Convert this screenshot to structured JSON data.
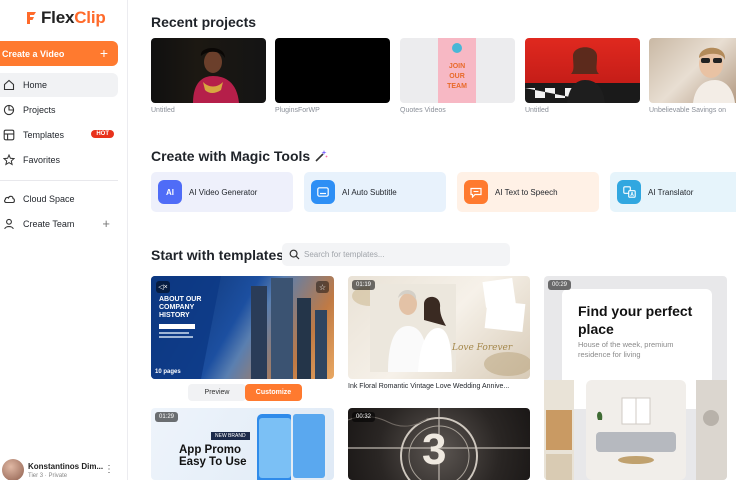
{
  "brand": {
    "logo_prefix": "Flex",
    "logo_suffix": "Clip",
    "accent": "#ff7a2f"
  },
  "sidebar": {
    "create_label": "Create a Video",
    "items": [
      {
        "label": "Home"
      },
      {
        "label": "Projects"
      },
      {
        "label": "Templates",
        "badge": "HOT"
      },
      {
        "label": "Favorites"
      },
      {
        "label": "Cloud Space"
      },
      {
        "label": "Create Team"
      }
    ],
    "user": {
      "name": "Konstantinos Dim...",
      "tier": "Tier 3 · Private"
    }
  },
  "recent": {
    "title": "Recent projects",
    "projects": [
      {
        "label": "Untitled"
      },
      {
        "label": "PluginsForWP"
      },
      {
        "label": "Quotes Videos",
        "thumb_text": "JOIN OUR TEAM"
      },
      {
        "label": "Untitled"
      },
      {
        "label": "Unbelievable Savings on"
      }
    ]
  },
  "magic": {
    "title": "Create with Magic Tools",
    "tools": [
      {
        "label": "AI Video Generator",
        "icon": "AI"
      },
      {
        "label": "AI Auto Subtitle",
        "icon": "subtitle-icon"
      },
      {
        "label": "AI Text to Speech",
        "icon": "speech-icon"
      },
      {
        "label": "AI Translator",
        "icon": "translate-icon"
      }
    ]
  },
  "templates": {
    "title": "Start with templates",
    "search_placeholder": "Search for templates...",
    "preview_label": "Preview",
    "customize_label": "Customize",
    "cards": [
      {
        "pages": "10 pages",
        "heading": "ABOUT OUR COMPANY HISTORY"
      },
      {
        "duration": "01:19",
        "title": "Ink Floral Romantic Vintage Love Wedding Annive...",
        "overlay": "Love Forever"
      },
      {
        "duration": "00:29",
        "heading": "Find your perfect place",
        "sub": "House of the week, premium residence for living"
      },
      {
        "duration": "01:29",
        "tag": "NEW BRAND",
        "heading": "App Promo Easy To Use"
      },
      {
        "duration": "00:32",
        "number": "3"
      }
    ]
  }
}
